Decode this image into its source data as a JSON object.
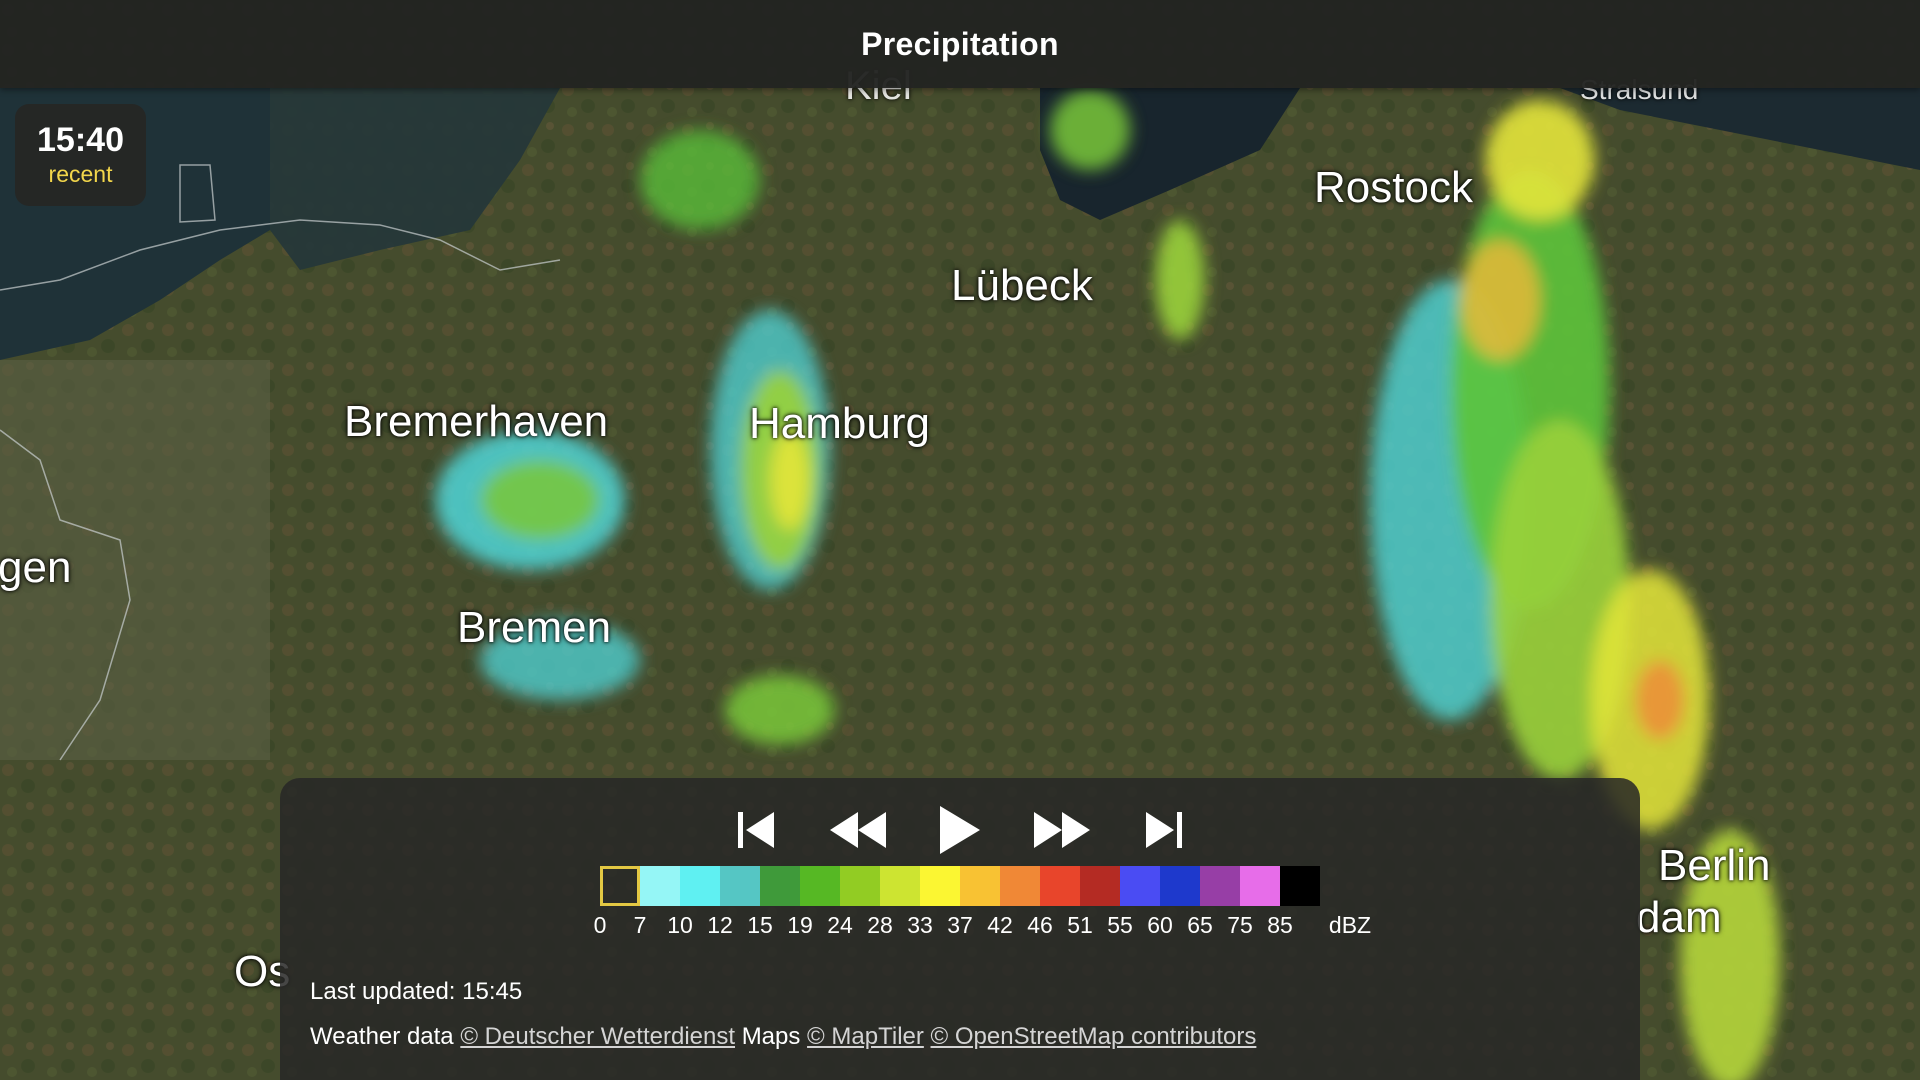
{
  "header": {
    "title": "Precipitation"
  },
  "time_badge": {
    "time": "15:40",
    "status": "recent"
  },
  "map": {
    "cities": [
      {
        "id": "kiel",
        "label": "Kiel"
      },
      {
        "id": "stralsund",
        "label": "Stralsund"
      },
      {
        "id": "rostock",
        "label": "Rostock"
      },
      {
        "id": "lubeck",
        "label": "Lübeck"
      },
      {
        "id": "bremerhaven",
        "label": "Bremerhaven"
      },
      {
        "id": "hamburg",
        "label": "Hamburg"
      },
      {
        "id": "gen",
        "label": "gen"
      },
      {
        "id": "bremen",
        "label": "Bremen"
      },
      {
        "id": "berlin",
        "label": "Berlin"
      },
      {
        "id": "dam",
        "label": "dam"
      },
      {
        "id": "os",
        "label": "Os"
      }
    ]
  },
  "controls": {
    "icons": [
      "skip-to-start-icon",
      "rewind-icon",
      "play-icon",
      "fast-forward-icon",
      "skip-to-end-icon"
    ]
  },
  "legend": {
    "colors": [
      "transparent",
      "#95f6f6",
      "#5ff0f2",
      "#55c6c4",
      "#3f9a3a",
      "#56b824",
      "#92cc23",
      "#cde431",
      "#fbf632",
      "#f8c233",
      "#f08836",
      "#e8452b",
      "#b42b23",
      "#4a4cf3",
      "#1e39cc",
      "#973ea6",
      "#e76de9",
      "#000000"
    ],
    "labels": [
      "0",
      "7",
      "10",
      "12",
      "15",
      "19",
      "24",
      "28",
      "33",
      "37",
      "42",
      "46",
      "51",
      "55",
      "60",
      "65",
      "75",
      "85",
      "dBZ"
    ]
  },
  "footer": {
    "last_updated": "Last updated: 15:45",
    "weather_prefix": "Weather data",
    "dwd_link": "© Deutscher Wetterdienst",
    "maps_prefix": "Maps",
    "maptiler_link": "© MapTiler",
    "osm_link": "© OpenStreetMap contributors"
  }
}
